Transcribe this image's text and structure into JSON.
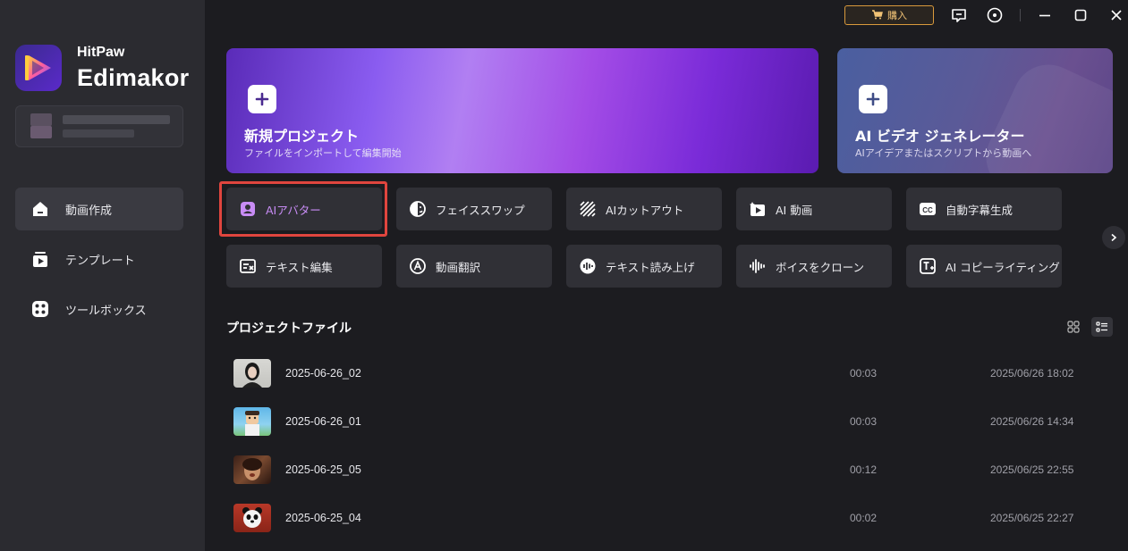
{
  "app": {
    "brand_small": "HitPaw",
    "brand_big": "Edimakor"
  },
  "topbar": {
    "buy_label": "購入",
    "accent": "#d99a3c"
  },
  "sidebar": {
    "items": [
      {
        "label": "動画作成",
        "icon": "home-icon",
        "active": true
      },
      {
        "label": "テンプレート",
        "icon": "template-icon",
        "active": false
      },
      {
        "label": "ツールボックス",
        "icon": "toolbox-icon",
        "active": false
      }
    ]
  },
  "hero": {
    "new_project": {
      "title": "新規プロジェクト",
      "subtitle": "ファイルをインポートして編集開始"
    },
    "ai_video": {
      "title": "AI ビデオ ジェネレーター",
      "subtitle": "AIアイデアまたはスクリプトから動画へ"
    }
  },
  "tools": [
    {
      "label": "AIアバター",
      "icon": "avatar-icon",
      "highlighted": true
    },
    {
      "label": "フェイススワップ",
      "icon": "face-swap-icon"
    },
    {
      "label": "AIカットアウト",
      "icon": "cutout-icon"
    },
    {
      "label": "AI 動画",
      "icon": "ai-video-icon"
    },
    {
      "label": "自動字幕生成",
      "icon": "cc-icon"
    },
    {
      "label": "テキスト編集",
      "icon": "text-edit-icon"
    },
    {
      "label": "動画翻訳",
      "icon": "translate-icon"
    },
    {
      "label": "テキスト読み上げ",
      "icon": "tts-icon"
    },
    {
      "label": "ボイスをクローン",
      "icon": "voice-clone-icon"
    },
    {
      "label": "AI コピーライティング",
      "icon": "copywriting-icon"
    }
  ],
  "projects": {
    "title": "プロジェクトファイル",
    "files": [
      {
        "name": "2025-06-26_02",
        "duration": "00:03",
        "date": "2025/06/26 18:02"
      },
      {
        "name": "2025-06-26_01",
        "duration": "00:03",
        "date": "2025/06/26 14:34"
      },
      {
        "name": "2025-06-25_05",
        "duration": "00:12",
        "date": "2025/06/25 22:55"
      },
      {
        "name": "2025-06-25_04",
        "duration": "00:02",
        "date": "2025/06/25 22:27"
      }
    ]
  },
  "colors": {
    "highlight_border": "#e0453e",
    "highlight_text": "#c88cf5"
  }
}
